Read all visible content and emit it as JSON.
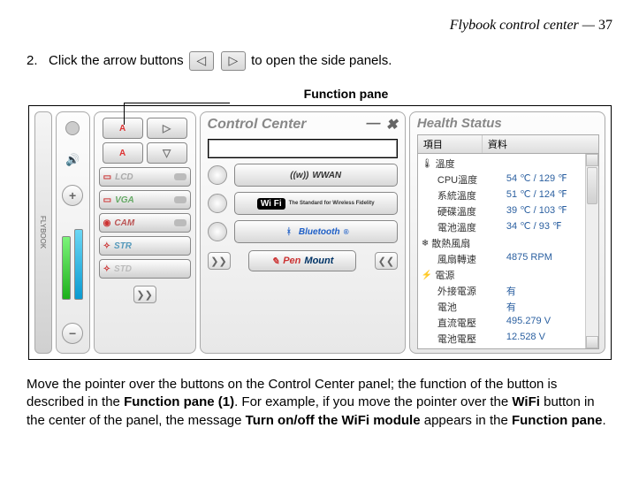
{
  "header": {
    "title": "Flybook control center —  ",
    "page": "37"
  },
  "step": {
    "num": "2.",
    "before": "Click the arrow buttons ",
    "after": " to open the side panels."
  },
  "callout": "Function pane",
  "left_tab": "FLYBOOK",
  "arrows": {
    "left_glyph": "◁",
    "right_glyph": "▷",
    "up_glyph": "△",
    "down_glyph": "▽"
  },
  "mini": {
    "A": "A"
  },
  "wide": {
    "lcd": "LCD",
    "vga": "VGA",
    "cam": "CAM",
    "str": "STR",
    "std": "STD"
  },
  "expand": {
    "right": "❯❯",
    "left": "❮❮"
  },
  "cc": {
    "title": "Control Center",
    "minimize": "—",
    "close": "✖",
    "wwan": "WWAN",
    "wwan_sig": "((ᴡ))",
    "wifi_logo": "Wi Fi",
    "wifi_sub": "The Standard for Wireless Fidelity",
    "bt": "Bluetooth",
    "bt_logo": "ᚼ",
    "penmount_pen": "Pen",
    "penmount_mount": "Mount"
  },
  "health": {
    "title": "Health Status",
    "col1": "項目",
    "col2": "資料",
    "rows": [
      {
        "icon": "🌡",
        "k": "溫度",
        "v": ""
      },
      {
        "icon": "",
        "k": "CPU溫度",
        "v": "54 ℃ / 129 ℉",
        "indent": true
      },
      {
        "icon": "",
        "k": "系統溫度",
        "v": "51 ℃ / 124 ℉",
        "indent": true
      },
      {
        "icon": "",
        "k": "硬碟溫度",
        "v": "39 ℃ / 103 ℉",
        "indent": true
      },
      {
        "icon": "",
        "k": "電池溫度",
        "v": "34 ℃ / 93 ℉",
        "indent": true
      },
      {
        "icon": "❄",
        "k": "散熱風扇",
        "v": ""
      },
      {
        "icon": "",
        "k": "風扇轉速",
        "v": "4875 RPM",
        "indent": true
      },
      {
        "icon": "⚡",
        "k": "電源",
        "v": ""
      },
      {
        "icon": "",
        "k": "外接電源",
        "v": "有",
        "indent": true
      },
      {
        "icon": "",
        "k": "電池",
        "v": "有",
        "indent": true
      },
      {
        "icon": "",
        "k": "直流電壓",
        "v": "495.279 V",
        "indent": true
      },
      {
        "icon": "",
        "k": "電池電壓",
        "v": "12.528 V",
        "indent": true
      }
    ]
  },
  "para": {
    "t1": "Move the pointer over the buttons on the Control Center panel; the function of the button is described in the ",
    "b1": "Function pane (1)",
    "t2": ". For example, if you move the pointer over the ",
    "b2": "WiFi",
    "t3": " button in the center of the panel, the message ",
    "b3": "Turn on/off the WiFi module",
    "t4": " appears in the ",
    "b4": "Function pane",
    "t5": "."
  }
}
